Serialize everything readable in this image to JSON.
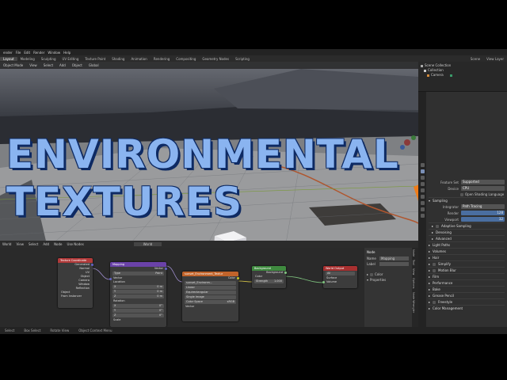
{
  "menubar": {
    "app": "ender",
    "items": [
      "File",
      "Edit",
      "Render",
      "Window",
      "Help"
    ]
  },
  "workspaces": {
    "tabs": [
      "Layout",
      "Modeling",
      "Sculpting",
      "UV Editing",
      "Texture Paint",
      "Shading",
      "Animation",
      "Rendering",
      "Compositing",
      "Geometry Nodes",
      "Scripting"
    ],
    "active": "Layout",
    "scene": "Scene",
    "view_layer": "View Layer"
  },
  "viewport": {
    "toolbar": [
      "Object Mode",
      "View",
      "Select",
      "Add",
      "Object",
      "Global"
    ],
    "overlay_title_line1": "ENVIRONMENTAL",
    "overlay_title_line2": "TEXTURES"
  },
  "outliner": {
    "rows": [
      "Scene Collection",
      "Collection",
      "Camera"
    ]
  },
  "properties": {
    "feature_set_label": "Feature Set",
    "feature_set": "Supported",
    "device_label": "Device",
    "device": "CPU",
    "osl_label": "Open Shading Language",
    "sampling_label": "Sampling",
    "integrator_label": "Integrator",
    "integrator": "Path Tracing",
    "render_label": "Render",
    "render_samples": "128",
    "viewport_label": "Viewport",
    "viewport_samples": "32",
    "adaptive_sampling": "Adaptive Sampling",
    "denoising": "Denoising",
    "advanced": "Advanced",
    "panels": [
      "Light Paths",
      "Volumes",
      "Hair",
      "Simplify",
      "Motion Blur",
      "Film",
      "Performance",
      "Bake",
      "Grease Pencil",
      "Freestyle",
      "Color Management"
    ]
  },
  "node_editor": {
    "header": [
      "World",
      "View",
      "Select",
      "Add",
      "Node",
      "Use Nodes"
    ],
    "world_name": "World",
    "nodes": {
      "texcoord": {
        "title": "Texture Coordinate",
        "outputs": [
          "Generated",
          "Normal",
          "UV",
          "Object",
          "Camera",
          "Window",
          "Reflection"
        ],
        "object_label": "Object",
        "instancer": "From Instancer"
      },
      "mapping": {
        "title": "Mapping",
        "output": "Vector",
        "type_label": "Type",
        "type": "Point",
        "vector": "Vector",
        "location": "Location",
        "loc": [
          "0 m",
          "0 m",
          "0 m"
        ],
        "rotation": "Rotation",
        "rot": [
          "0°",
          "0°",
          "0°"
        ],
        "scale": "Scale"
      },
      "envtex": {
        "title": "sunset_Environment_Textur",
        "output": "Color",
        "image": "sunset_Environm...",
        "interp": "Linear",
        "proj": "Equirectangular",
        "source": "Single Image",
        "color_space_label": "Color Space",
        "color_space": "sRGB",
        "vector": "Vector"
      },
      "background": {
        "title": "Background",
        "output": "Background",
        "color": "Color",
        "strength_label": "Strength",
        "strength": "1.000"
      },
      "output": {
        "title": "World Output",
        "target": "All",
        "surface": "Surface",
        "volume": "Volume"
      }
    }
  },
  "node_sidebar": {
    "section": "Node",
    "name_label": "Name",
    "name": "Mapping",
    "label_label": "Label",
    "color": "Color",
    "properties": "Properties",
    "tabs": [
      "Node",
      "Tool",
      "View",
      "Options",
      "Node Wrangler"
    ]
  },
  "status": {
    "items": [
      "Select",
      "Box Select",
      "Rotate View",
      "Object Context Menu"
    ]
  },
  "colors": {
    "title_fill": "#8ab4f0",
    "title_outline": "#0e2a63",
    "blender_orange": "#f07d1a",
    "blender_blue": "#265a9a"
  }
}
